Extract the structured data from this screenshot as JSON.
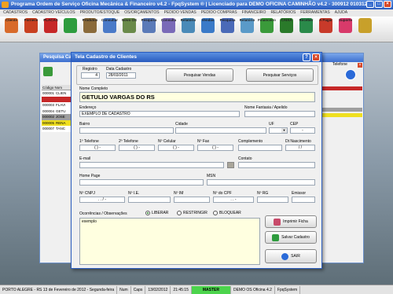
{
  "app": {
    "title": "Programa Ordem de Serviço Oficina Mecânica & Financeiro v4.2 - FpqSystem ® | Licenciado para  DEMO OFICINA CAMINHÃO v4.2 - 300912 010312",
    "menu": [
      "CADASTROS",
      "CADASTRO VEÍCULOS",
      "PRODUTO/ESTOQUE",
      "OS/ORÇAMENTOS",
      "PEDIDO VENDAS",
      "PEDIDO COMPRAS",
      "FINANCEIRO",
      "RELATÓRIOS",
      "FERRAMENTAS",
      "AJUDA"
    ],
    "toolbar": [
      {
        "label": "Cliente",
        "icon": "client-icon",
        "color": "#d86a2a"
      },
      {
        "label": "Fornece",
        "icon": "supplier-icon",
        "color": "#c84020"
      },
      {
        "label": "PLACAS",
        "icon": "truck-icon",
        "color": "#c62828"
      },
      {
        "label": "",
        "icon": "add-vehicle-icon",
        "color": "#2e9c3e"
      },
      {
        "label": "Produtos",
        "icon": "products-icon",
        "color": "#8a6a3a"
      },
      {
        "label": "Consultar",
        "icon": "consult-icon",
        "color": "#4a7ac8"
      },
      {
        "label": "Novo OS",
        "icon": "new-os-icon",
        "color": "#6a8a4a"
      },
      {
        "label": "Pesquisa",
        "icon": "search-os-icon",
        "color": "#5a7ab8"
      },
      {
        "label": "Consulta",
        "icon": "consult-os-icon",
        "color": "#7a6ab8"
      },
      {
        "label": "Relatório",
        "icon": "report-icon",
        "color": "#4a8ab8"
      },
      {
        "label": "Vendas",
        "icon": "sales-icon",
        "color": "#3a7ac8"
      },
      {
        "label": "Pesquisa",
        "icon": "search-sales-icon",
        "color": "#4a6ab8"
      },
      {
        "label": "Relatório",
        "icon": "report-sales-icon",
        "color": "#5a9ac8"
      },
      {
        "label": "Financeiro",
        "icon": "finance-icon",
        "color": "#3a9a3a"
      },
      {
        "label": "CAIXA",
        "icon": "cashier-icon",
        "color": "#2a7a2a"
      },
      {
        "label": "Receber",
        "icon": "receive-icon",
        "color": "#2a8a4a"
      },
      {
        "label": "A Pagar",
        "icon": "pay-icon",
        "color": "#c83a2a"
      },
      {
        "label": "Suporte",
        "icon": "support-icon",
        "color": "#d83a6a"
      },
      {
        "label": "",
        "icon": "exit-icon",
        "color": "#c8a02a"
      }
    ]
  },
  "background_window": {
    "title": "Pesquisa Ca",
    "grid_header": "Código  Nom",
    "rows": [
      {
        "code": "000001",
        "name": "CLIEN",
        "color": "#ffffff"
      },
      {
        "code": "",
        "name": "",
        "color": "#c62828"
      },
      {
        "code": "000003",
        "name": "FLAVI",
        "color": "#ffffff"
      },
      {
        "code": "000004",
        "name": "GETU",
        "color": "#ffffff"
      },
      {
        "code": "000002",
        "name": "JOSE",
        "color": "#9e9e9e"
      },
      {
        "code": "000005",
        "name": "RENA",
        "color": "#f0e020"
      },
      {
        "code": "000007",
        "name": "TANC",
        "color": "#ffffff"
      }
    ],
    "right_label": "Telefone"
  },
  "dialog": {
    "title": "Tela Cadastro de Clientes",
    "registro_label": "Registro",
    "registro_value": "4",
    "data_label": "Data Cadastro",
    "data_value": "28/03/2011",
    "btn_pesquisar_vendas": "Pesquisar Vendas",
    "btn_pesquisar_servicos": "Pesquisar Serviços",
    "nome_label": "Nome Completo",
    "nome_value": "GETULIO VARGAS DO RS",
    "endereco_label": "Endereço",
    "endereco_value": "EXEMPLO DE CADASTRO",
    "fantasia_label": "Nome Fantasia / Apelido",
    "bairro_label": "Bairro",
    "cidade_label": "Cidade",
    "uf_label": "UF",
    "cep_label": "CEP",
    "cep_value": "  -",
    "tel1_label": "1º Telefone",
    "tel1_value": "(  )  -",
    "tel2_label": "2º Telefone",
    "tel2_value": "(  )  -",
    "cel_label": "Nº Celular",
    "cel_value": "(  )  -",
    "fax_label": "Nº Fax",
    "fax_value": "(  )  -",
    "complemento_label": "Complemento",
    "nasc_label": "Dt Nascimento",
    "nasc_value": "/  /",
    "email_label": "E-mail",
    "contato_label": "Contato",
    "homepage_label": "Home Page",
    "msn_label": "MSN",
    "cnpj_label": "Nº CNPJ",
    "cnpj_value": ".  .  /  -",
    "ie_label": "Nº I.E.",
    "im_label": "Nº IM",
    "cpf_label": "Nº do CPF",
    "cpf_value": ".  .  -",
    "rg_label": "Nº RG",
    "emissor_label": "Emissor",
    "ocorrencias_label": "Ocorrências / Observações",
    "radio_liberar": "LIBERAR",
    "radio_restringir": "RESTRINGIR",
    "radio_bloquear": "BLOQUEAR",
    "obs_value": "exemplo",
    "btn_imprimir": "Imprimir Ficha",
    "btn_salvar": "Salvar Cadastro",
    "btn_sair": "SAIR"
  },
  "statusbar": {
    "location": "PORTO ALEGRE - RS 13 de Fevereiro de 2012 - Segunda-feira",
    "num": "Num",
    "caps": "Caps",
    "date": "13/02/2012",
    "time": "21:45:15",
    "mode": "MASTER",
    "license": "DEMO OS Oficina 4.2",
    "brand": "FpqSystem"
  }
}
